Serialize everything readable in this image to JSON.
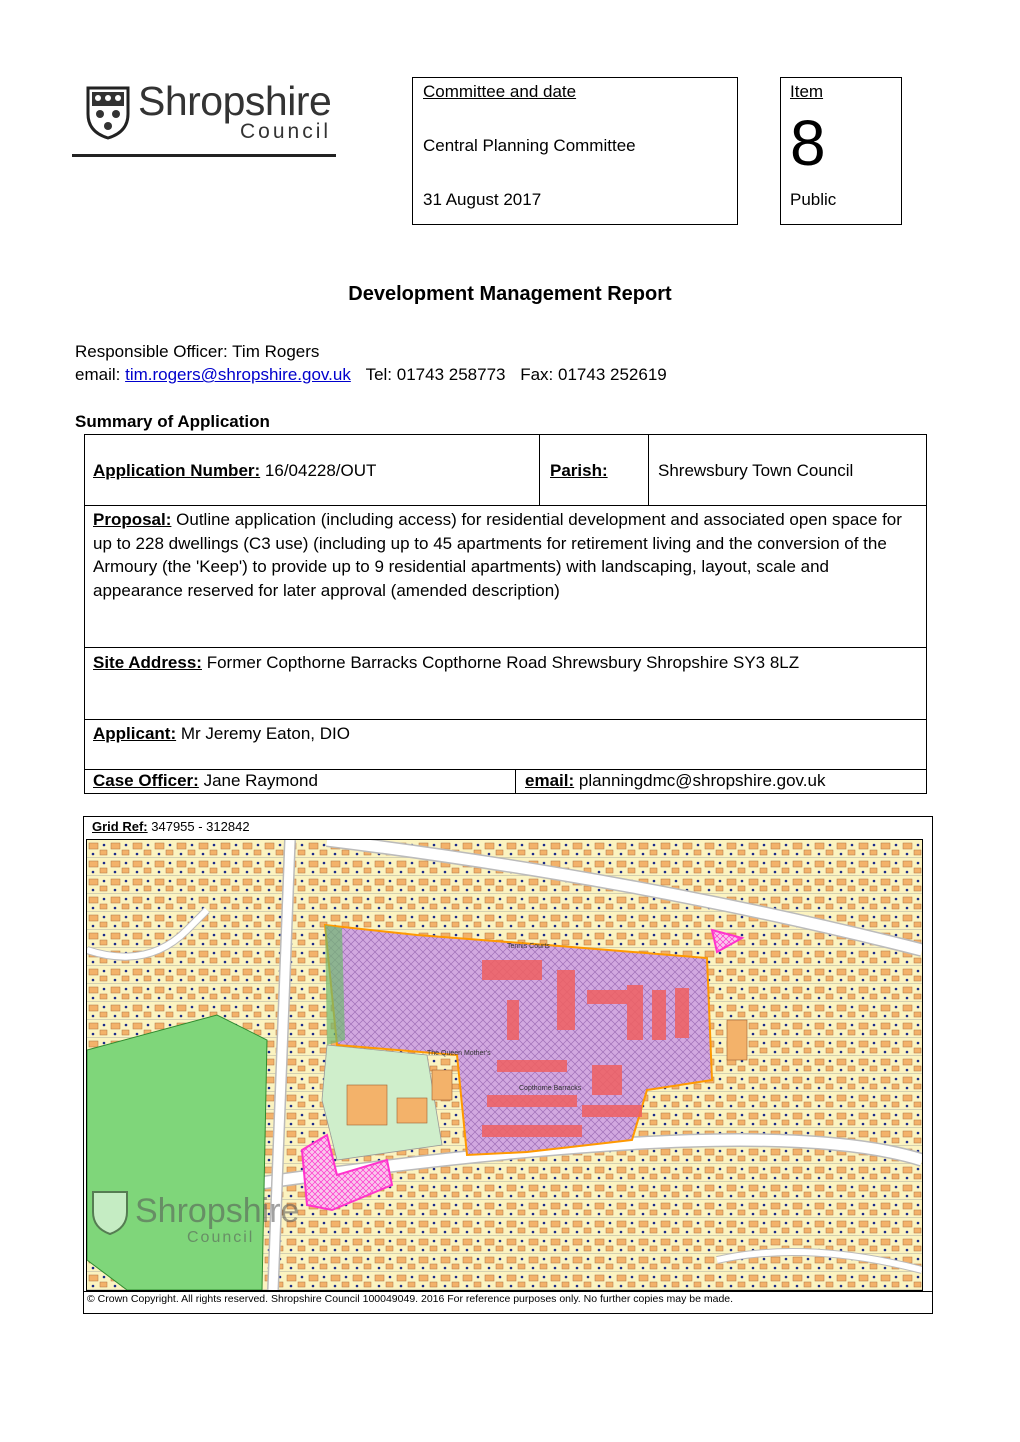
{
  "logo": {
    "name": "Shropshire",
    "sub": "Council"
  },
  "committee": {
    "heading": "Committee and date",
    "name": "Central Planning Committee",
    "date": "31 August 2017"
  },
  "item": {
    "heading": "Item",
    "number": "8",
    "status": "Public"
  },
  "title": "Development Management Report",
  "officer": {
    "line": "Responsible Officer: Tim Rogers",
    "email_label": "email:",
    "email": "tim.rogers@shropshire.gov.uk",
    "tel": "Tel: 01743 258773",
    "fax": "Fax: 01743 252619"
  },
  "summary_heading": "Summary of Application",
  "summary": {
    "app_label": "Application Number:",
    "app_value": "16/04228/OUT",
    "parish_label": "Parish:",
    "parish_value": "Shrewsbury Town Council",
    "proposal_label": "Proposal:",
    "proposal_value": "Outline application (including access) for residential development and associated open space for up to 228 dwellings (C3 use) (including up to 45 apartments for retirement living and the conversion of the Armoury (the 'Keep') to provide up to 9 residential apartments) with landscaping, layout, scale and appearance reserved for later approval (amended description)",
    "site_label": "Site Address:",
    "site_value": "Former Copthorne Barracks Copthorne Road Shrewsbury Shropshire SY3 8LZ",
    "applicant_label": "Applicant:",
    "applicant_value": "Mr Jeremy Eaton, DIO",
    "officer_label": "Case Officer:",
    "officer_value": "Jane Raymond",
    "email_label": "email:",
    "email_value": "planningdmc@shropshire.gov.uk"
  },
  "map": {
    "grid_label": "Grid Ref:",
    "grid_value": "347955 - 312842",
    "labels": [
      "Copthorne Barracks",
      "The Queen Mother's",
      "Tennis Courts"
    ],
    "watermark_name": "Shropshire",
    "watermark_sub": "Council",
    "copyright": "© Crown Copyright. All rights reserved.  Shropshire Council 100049049. 2016  For reference purposes only. No further copies may be made.",
    "colors": {
      "background": "#fbf3c0",
      "site": "#c8a0d8",
      "buildings": "#f0a860",
      "green": "#7fd67a",
      "boundary": "#ff9900",
      "pink": "#ff33cc"
    }
  }
}
